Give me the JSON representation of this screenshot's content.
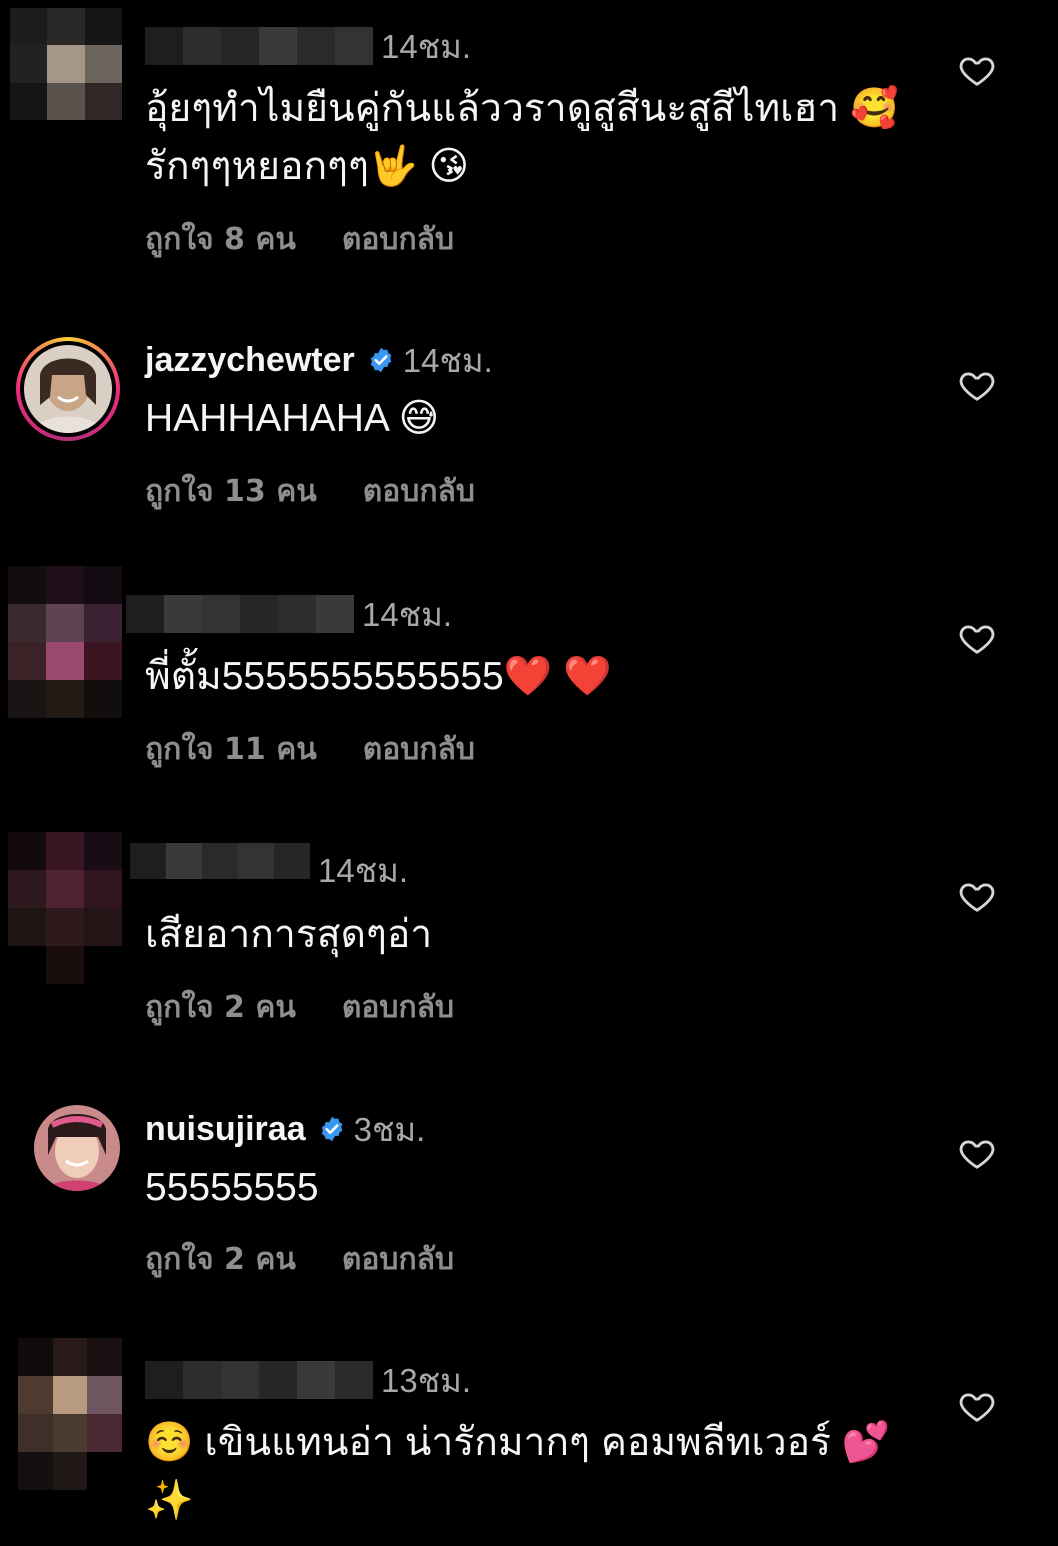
{
  "comments": [
    {
      "username": "",
      "time": "14ชม.",
      "text": "อุ้ยๆทำไมยืนคู่กันแล้ววราดูสูสีนะสูสีไทเฮา 🥰รักๆๆหยอกๆๆ🤟 😘",
      "likes": "ถูกใจ 8 คน",
      "reply": "ตอบกลับ"
    },
    {
      "username": "jazzychewter",
      "time": "14ชม.",
      "text": "HAHHAHAHA 😅",
      "likes": "ถูกใจ 13 คน",
      "reply": "ตอบกลับ"
    },
    {
      "username": "",
      "time": "14ชม.",
      "text": "พี่ตั้ม5555555555555❤️ ❤️",
      "likes": "ถูกใจ 11 คน",
      "reply": "ตอบกลับ"
    },
    {
      "username": "",
      "time": "14ชม.",
      "text": "เสียอาการสุดๆอ่า",
      "likes": "ถูกใจ 2 คน",
      "reply": "ตอบกลับ"
    },
    {
      "username": "nuisujiraa",
      "time": "3ชม.",
      "text": "55555555",
      "likes": "ถูกใจ 2 คน",
      "reply": "ตอบกลับ"
    },
    {
      "username": "",
      "time": "13ชม.",
      "text": "☺️ เขินแทนอ่า น่ารักมากๆ คอมพลีทเวอร์ 💕 ✨",
      "likes": "",
      "reply": ""
    }
  ],
  "icons": {
    "like": "heart-outline-icon",
    "verified": "verified-badge-icon"
  },
  "colors": {
    "background": "#000000",
    "text": "#f5f5f5",
    "secondary": "#a8a8a8",
    "verified": "#3897f0"
  }
}
